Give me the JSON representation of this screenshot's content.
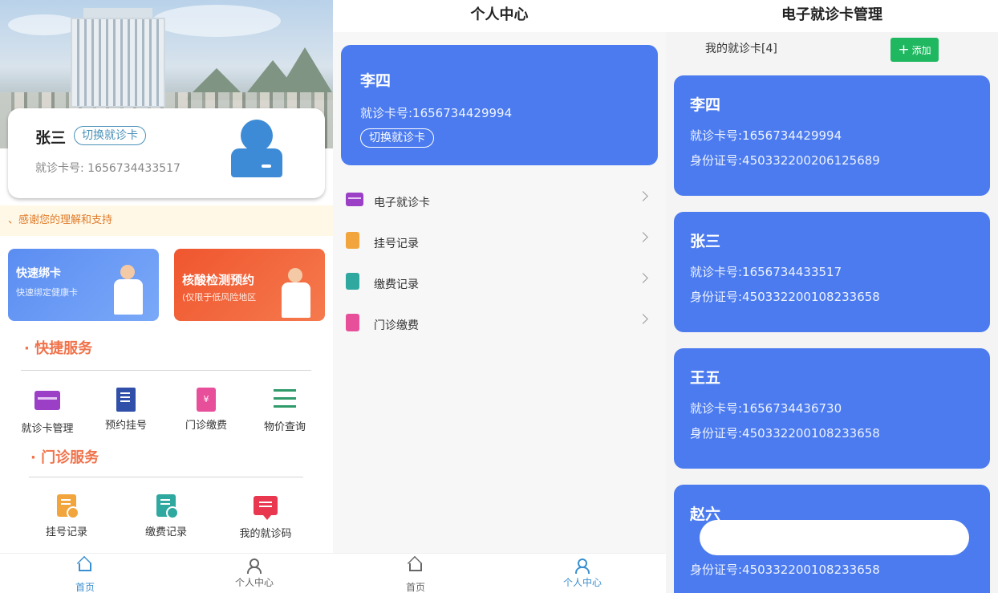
{
  "home": {
    "user_name": "张三",
    "switch_card": "切换就诊卡",
    "card_no_label": "就诊卡号:",
    "card_no": "1656734433517",
    "notice": "、感谢您的理解和支持",
    "promo_bind": {
      "title": "快速绑卡",
      "subtitle": "快速绑定健康卡"
    },
    "promo_test": {
      "title": "核酸检测预约",
      "subtitle": "(仅限于低风险地区"
    },
    "quick_services_title": "· 快捷服务",
    "quick_services": [
      {
        "label": "就诊卡管理",
        "icon": "card-icon"
      },
      {
        "label": "预约挂号",
        "icon": "book-icon"
      },
      {
        "label": "门诊缴费",
        "icon": "bill-icon"
      },
      {
        "label": "物价查询",
        "icon": "list-icon"
      }
    ],
    "outpatient_title": "· 门诊服务",
    "outpatient_services": [
      {
        "label": "挂号记录",
        "icon": "register-record-icon"
      },
      {
        "label": "缴费记录",
        "icon": "payment-record-icon"
      },
      {
        "label": "我的就诊码",
        "icon": "message-code-icon"
      }
    ]
  },
  "tabs": [
    {
      "label": "首页",
      "icon": "home-icon"
    },
    {
      "label": "个人中心",
      "icon": "people-icon"
    }
  ],
  "personal": {
    "title": "个人中心",
    "user_name": "李四",
    "card_no_text": "就诊卡号:1656734429994",
    "switch_card": "切换就诊卡",
    "menu": [
      {
        "label": "电子就诊卡",
        "icon": "card-icon"
      },
      {
        "label": "挂号记录",
        "icon": "register-record-icon"
      },
      {
        "label": "缴费记录",
        "icon": "payment-record-icon"
      },
      {
        "label": "门诊缴费",
        "icon": "bill-icon"
      }
    ]
  },
  "manage": {
    "title": "电子就诊卡管理",
    "count_text": "我的就诊卡[4]",
    "add_label": "添加",
    "cards": [
      {
        "name": "李四",
        "card_no": "就诊卡号:1656734429994",
        "id_no": "身份证号:450332200206125689"
      },
      {
        "name": "张三",
        "card_no": "就诊卡号:1656734433517",
        "id_no": "身份证号:450332200108233658"
      },
      {
        "name": "王五",
        "card_no": "就诊卡号:1656734436730",
        "id_no": "身份证号:450332200108233658"
      },
      {
        "name": "赵六",
        "card_no": "",
        "id_no": "身份证号:450332200108233658"
      }
    ]
  },
  "colors": {
    "primary_blue": "#4b7bef",
    "accent_orange": "#f0724a",
    "add_green": "#1fb860",
    "tab_active": "#3a8fd0"
  }
}
